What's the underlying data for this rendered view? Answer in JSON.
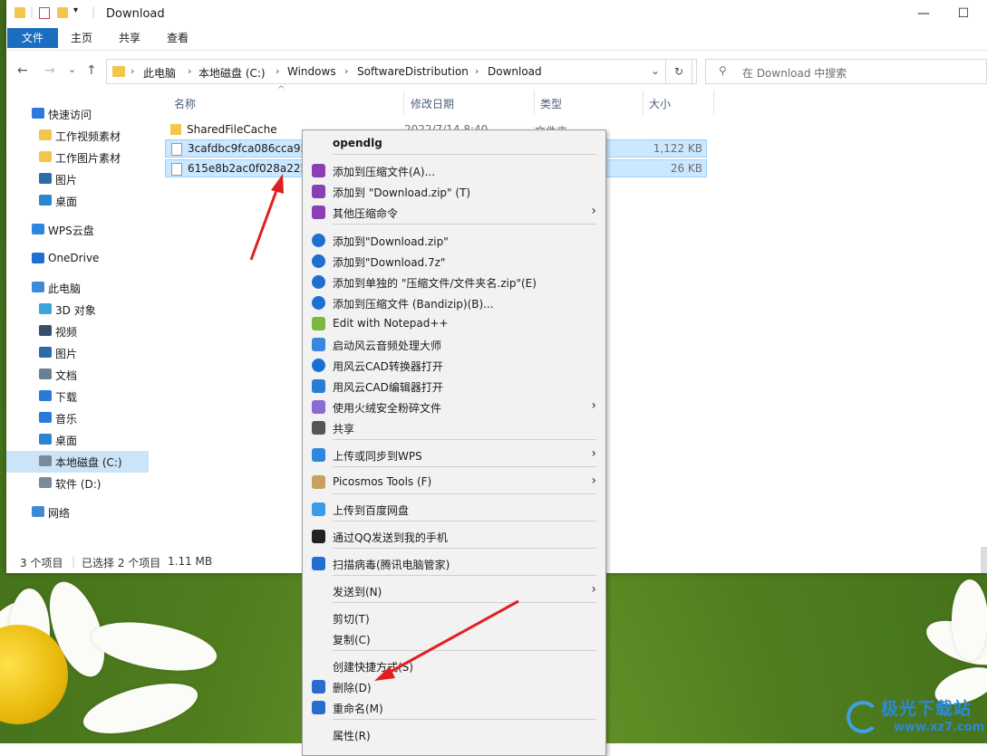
{
  "window": {
    "title": "Download",
    "minimize": "—",
    "maximize": "☐"
  },
  "ribbon": {
    "tabs": [
      "文件",
      "主页",
      "共享",
      "查看"
    ]
  },
  "nav": {
    "back": "←",
    "forward": "→",
    "recent": "⌄",
    "up": "↑",
    "breadcrumb": [
      "此电脑",
      "本地磁盘 (C:)",
      "Windows",
      "SoftwareDistribution",
      "Download"
    ],
    "refresh": "↻",
    "search_placeholder": "在 Download 中搜索"
  },
  "sidebar": {
    "items": [
      {
        "label": "快速访问",
        "icon": "star-icon",
        "color": "#2b79d8"
      },
      {
        "label": "工作视频素材",
        "icon": "folder-icon",
        "color": "#f3c64b"
      },
      {
        "label": "工作图片素材",
        "icon": "folder-icon",
        "color": "#f3c64b"
      },
      {
        "label": "图片",
        "icon": "pictures-icon",
        "color": "#2d6aa8"
      },
      {
        "label": "桌面",
        "icon": "desktop-icon",
        "color": "#2b85d0"
      },
      {
        "label": "WPS云盘",
        "icon": "cloud-icon",
        "color": "#2f86e0"
      },
      {
        "label": "OneDrive",
        "icon": "onedrive-icon",
        "color": "#1e6fd0"
      },
      {
        "label": "此电脑",
        "icon": "computer-icon",
        "color": "#3d8bd6"
      },
      {
        "label": "3D 对象",
        "icon": "cube-icon",
        "color": "#3aa5d6"
      },
      {
        "label": "视频",
        "icon": "video-icon",
        "color": "#3a4e6a"
      },
      {
        "label": "图片",
        "icon": "pictures-icon",
        "color": "#2d6aa8"
      },
      {
        "label": "文档",
        "icon": "document-icon",
        "color": "#6b7f96"
      },
      {
        "label": "下载",
        "icon": "download-icon",
        "color": "#2b79d8"
      },
      {
        "label": "音乐",
        "icon": "music-icon",
        "color": "#2b79d8"
      },
      {
        "label": "桌面",
        "icon": "desktop-icon",
        "color": "#2b85d0"
      },
      {
        "label": "本地磁盘 (C:)",
        "icon": "drive-icon",
        "color": "#7a8a99"
      },
      {
        "label": "软件 (D:)",
        "icon": "drive-icon",
        "color": "#7a8a99"
      },
      {
        "label": "网络",
        "icon": "network-icon",
        "color": "#3d8bd6"
      }
    ]
  },
  "columns": {
    "name": "名称",
    "date": "修改日期",
    "type": "类型",
    "size": "大小",
    "sort": "^"
  },
  "files": [
    {
      "name": "SharedFileCache",
      "date": "2022/7/14 8:40",
      "type": "文件夹",
      "size": ""
    },
    {
      "name": "3cafdbc9fca086cca95e",
      "date": "",
      "type": "",
      "size": "1,122 KB"
    },
    {
      "name": "615e8b2ac0f028a2253",
      "date": "",
      "type": "",
      "size": "26 KB"
    }
  ],
  "status": {
    "count": "3 个项目",
    "selected": "已选择 2 个项目",
    "size": "1.11 MB"
  },
  "context_menu": {
    "items": [
      {
        "label": "opendlg",
        "icon": "",
        "arrow": ""
      },
      {
        "label": "添加到压缩文件(A)...",
        "icon": "winrar-icon",
        "color": "#8a3fb2",
        "arrow": ""
      },
      {
        "label": "添加到 \"Download.zip\" (T)",
        "icon": "winrar-icon",
        "color": "#8a3fb2",
        "arrow": ""
      },
      {
        "label": "其他压缩命令",
        "icon": "winrar-icon",
        "color": "#8a3fb2",
        "arrow": "›"
      },
      {
        "label": "添加到\"Download.zip\"",
        "icon": "bandizip-icon",
        "color": "#1f6fd0",
        "arrow": ""
      },
      {
        "label": "添加到\"Download.7z\"",
        "icon": "bandizip-icon",
        "color": "#1f6fd0",
        "arrow": ""
      },
      {
        "label": "添加到单独的 \"压缩文件/文件夹名.zip\"(E)",
        "icon": "bandizip-icon",
        "color": "#1f6fd0",
        "arrow": ""
      },
      {
        "label": "添加到压缩文件 (Bandizip)(B)...",
        "icon": "bandizip-icon",
        "color": "#1f6fd0",
        "arrow": ""
      },
      {
        "label": "Edit with Notepad++",
        "icon": "notepadpp-icon",
        "color": "#7bb83d",
        "arrow": ""
      },
      {
        "label": "启动风云音频处理大师",
        "icon": "audio-icon",
        "color": "#3b86e0",
        "arrow": ""
      },
      {
        "label": "用风云CAD转换器打开",
        "icon": "cad-converter-icon",
        "color": "#1a6fd2",
        "arrow": ""
      },
      {
        "label": "用风云CAD编辑器打开",
        "icon": "cad-editor-icon",
        "color": "#2a7dd6",
        "arrow": ""
      },
      {
        "label": "使用火绒安全粉碎文件",
        "icon": "shredder-icon",
        "color": "#8b6ad1",
        "arrow": "›"
      },
      {
        "label": "共享",
        "icon": "share-icon",
        "color": "#555555",
        "arrow": ""
      },
      {
        "label": "上传或同步到WPS",
        "icon": "wps-cloud-icon",
        "color": "#2f86e0",
        "arrow": "›"
      },
      {
        "label": "Picosmos Tools (F)",
        "icon": "picosmos-icon",
        "color": "#c8a060",
        "arrow": "›"
      },
      {
        "label": "上传到百度网盘",
        "icon": "baidu-netdisk-icon",
        "color": "#3a9be8",
        "arrow": ""
      },
      {
        "label": "通过QQ发送到我的手机",
        "icon": "qq-icon",
        "color": "#222222",
        "arrow": ""
      },
      {
        "label": "扫描病毒(腾讯电脑管家)",
        "icon": "tencent-shield-icon",
        "color": "#1f6fd0",
        "arrow": ""
      },
      {
        "label": "发送到(N)",
        "icon": "",
        "arrow": "›"
      },
      {
        "label": "剪切(T)",
        "icon": "",
        "arrow": ""
      },
      {
        "label": "复制(C)",
        "icon": "",
        "arrow": ""
      },
      {
        "label": "创建快捷方式(S)",
        "icon": "",
        "arrow": ""
      },
      {
        "label": "删除(D)",
        "icon": "uac-shield-icon",
        "color": "#2a6bd0",
        "arrow": ""
      },
      {
        "label": "重命名(M)",
        "icon": "uac-shield-icon",
        "color": "#2a6bd0",
        "arrow": ""
      },
      {
        "label": "属性(R)",
        "icon": "",
        "arrow": ""
      }
    ]
  },
  "watermark": {
    "line1": "极光下载站",
    "line2": "www.xz7.com"
  },
  "colors": {
    "selection": "#cce8ff",
    "annotation_arrow": "#e02020",
    "file_tab": "#1a6dbf"
  }
}
